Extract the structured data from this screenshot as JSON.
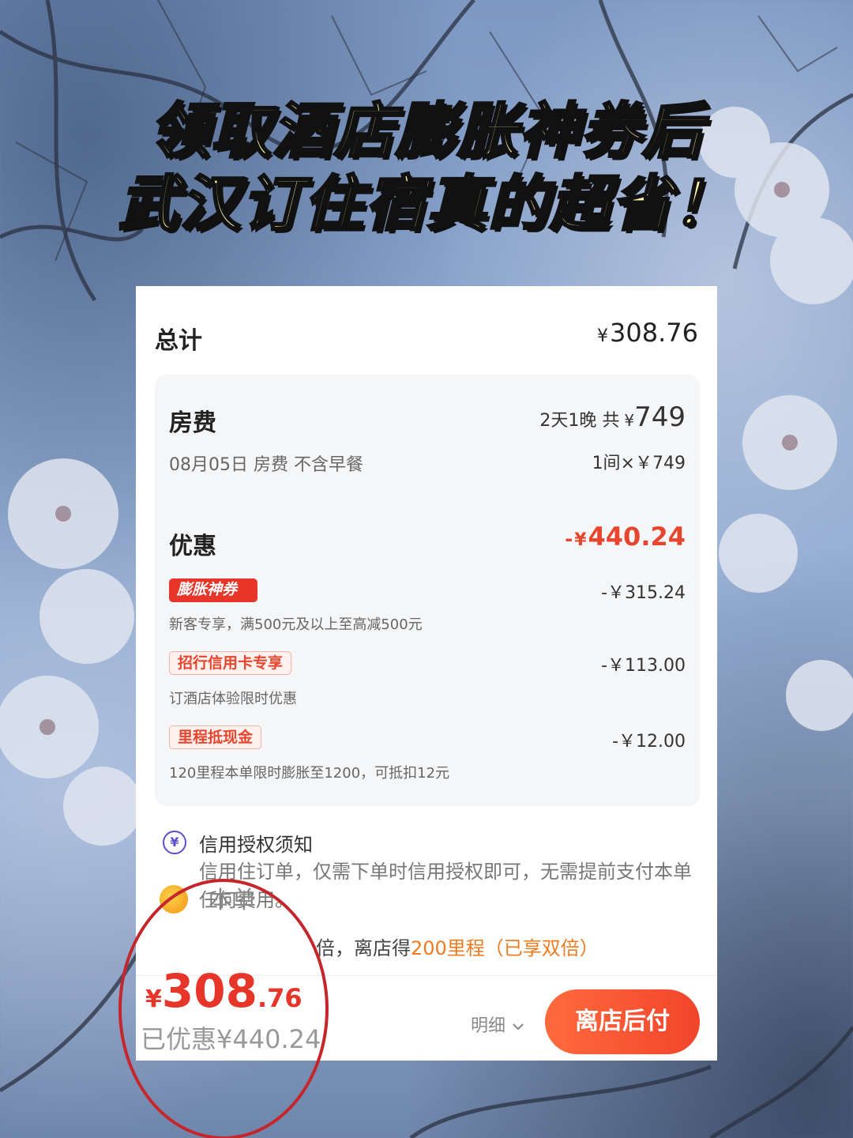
{
  "headline": {
    "line1": "领取酒店膨胀神券后",
    "line2": "武汉订住宿真的超省！"
  },
  "total": {
    "label": "总计",
    "currency": "¥",
    "amount": "308.76"
  },
  "room": {
    "title": "房费",
    "summary_prefix": "2天1晚 共",
    "currency": "¥",
    "summary_amount": "749",
    "line_desc": "08月05日 房费 不含早餐",
    "line_amount": "1间×￥749"
  },
  "discount": {
    "title": "优惠",
    "total_prefix": "-",
    "currency": "¥",
    "total_amount": "440.24",
    "items": [
      {
        "tag": "膨胀神券",
        "amount": "-￥315.24",
        "desc": "新客专享，满500元及以上至高减500元"
      },
      {
        "tag": "招行信用卡专享",
        "amount": "-￥113.00",
        "desc": "订酒店体验限时优惠"
      },
      {
        "tag": "里程抵现金",
        "amount": "-￥12.00",
        "desc": "120里程本单限时膨胀至1200，可抵扣12元"
      }
    ]
  },
  "notice": {
    "icon_symbol": "¥",
    "title": "信用授权须知",
    "text": "信用住订单，仅需下单时信用授权即可，无需提前支付本单任何费用。"
  },
  "partial_text": "本单",
  "mileage": {
    "prefix": "倍，离店得",
    "highlight": "200里程（已享双倍）"
  },
  "footer": {
    "currency": "¥",
    "price_int": "308",
    "price_dec": ".76",
    "saved": "已优惠¥440.24",
    "detail_label": "明细",
    "pay_button": "离店后付"
  },
  "colors": {
    "accent_red": "#e8352a",
    "mileage_orange": "#f07a1e",
    "headline_yellow": "#fff6a8",
    "notice_purple": "#5b4fd1"
  }
}
